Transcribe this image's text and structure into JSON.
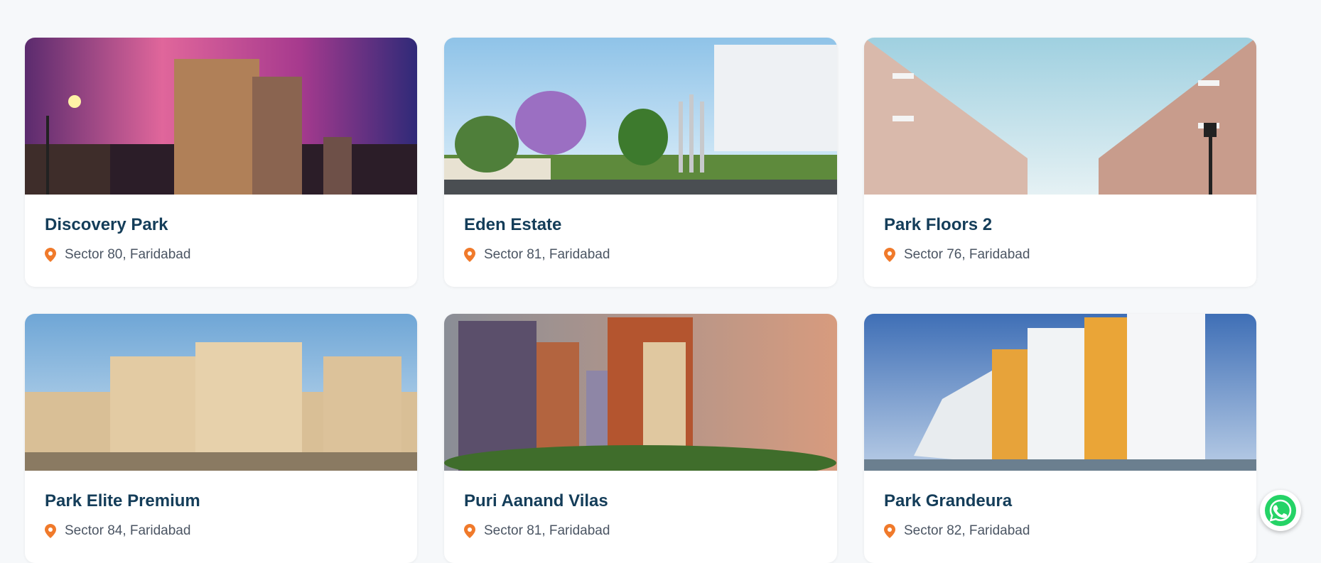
{
  "properties": [
    {
      "name": "Discovery Park",
      "location": "Sector 80, Faridabad"
    },
    {
      "name": "Eden Estate",
      "location": "Sector 81, Faridabad"
    },
    {
      "name": "Park Floors 2",
      "location": "Sector 76, Faridabad"
    },
    {
      "name": "Park Elite Premium",
      "location": "Sector 84, Faridabad"
    },
    {
      "name": "Puri Aanand Vilas",
      "location": "Sector 81, Faridabad"
    },
    {
      "name": "Park Grandeura",
      "location": "Sector 82, Faridabad"
    }
  ],
  "colors": {
    "title": "#143d59",
    "pin": "#f07a2b",
    "whatsapp": "#25d366"
  },
  "icons": {
    "location": "location-pin-icon",
    "chat": "whatsapp-icon"
  }
}
